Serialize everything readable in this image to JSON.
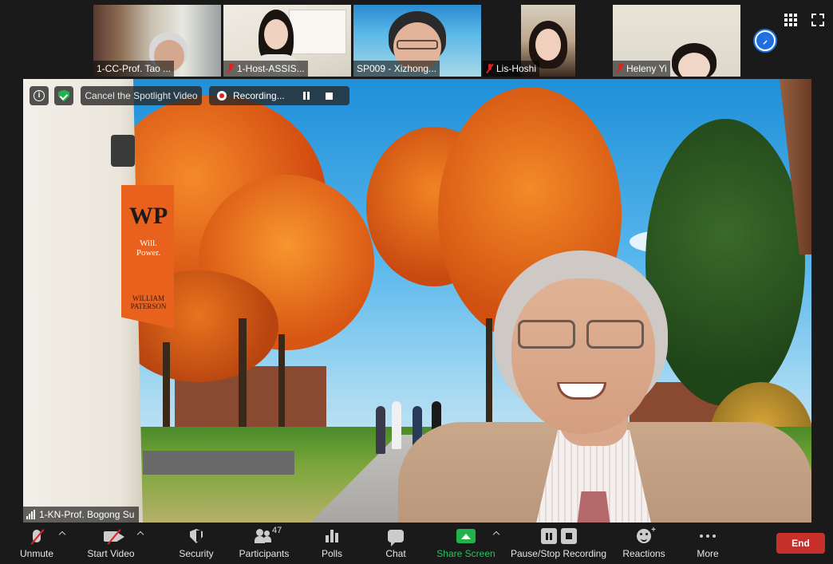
{
  "gallery": {
    "participants": [
      {
        "label": "1-CC-Prof. Tao ...",
        "muted": false
      },
      {
        "label": "1-Host-ASSIS...",
        "muted": true
      },
      {
        "label": "SP009 - Xizhong...",
        "muted": false
      },
      {
        "label": "Lis-Hoshi",
        "muted": true
      },
      {
        "label": "Heleny Yi",
        "muted": true
      }
    ],
    "next_page_icon": "chevron-right-icon",
    "view_icon": "grid-icon",
    "fullscreen_icon": "fullscreen-icon"
  },
  "spotlight": {
    "cancel_label": "Cancel the Spotlight Video",
    "recording_label": "Recording...",
    "speaker_name": "1-KN-Prof. Bogong Su",
    "banner_logo": "WP",
    "banner_tagline_1": "Will.",
    "banner_tagline_2": "Power.",
    "banner_base_1": "WILLIAM",
    "banner_base_2": "PATERSON"
  },
  "toolbar": {
    "unmute_label": "Unmute",
    "start_video_label": "Start Video",
    "security_label": "Security",
    "participants_label": "Participants",
    "participants_count": "47",
    "polls_label": "Polls",
    "chat_label": "Chat",
    "share_screen_label": "Share Screen",
    "record_label": "Pause/Stop Recording",
    "reactions_label": "Reactions",
    "more_label": "More",
    "end_label": "End"
  },
  "colors": {
    "share_green": "#22b24c",
    "end_red": "#c8312b",
    "muted_red": "#e02020",
    "accent_blue": "#1f6fe0"
  }
}
